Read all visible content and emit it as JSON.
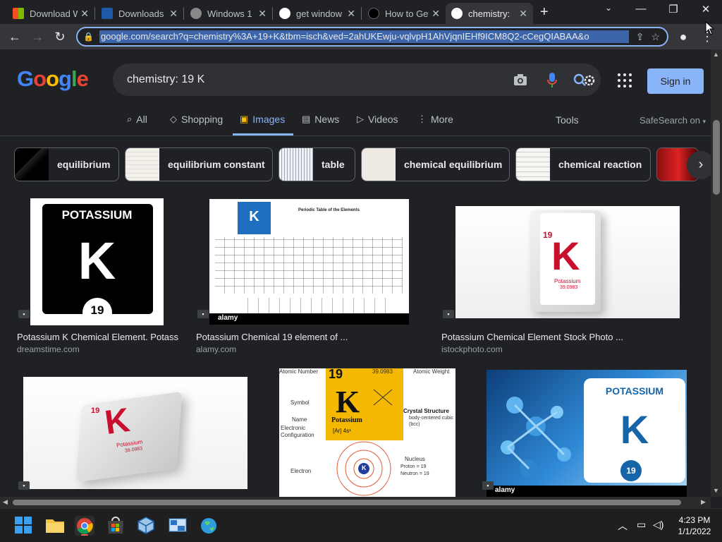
{
  "browser": {
    "tabs": [
      {
        "label": "Download W",
        "active": false
      },
      {
        "label": "Downloads",
        "active": false
      },
      {
        "label": "Windows 1",
        "active": false
      },
      {
        "label": "get window",
        "active": false
      },
      {
        "label": "How to Get",
        "active": false
      },
      {
        "label": "chemistry:",
        "active": true
      }
    ],
    "new_tab": "+",
    "url": "google.com/search?q=chemistry%3A+19+K&tbm=isch&ved=2ahUKEwju-vqlvpH1AhVjqnIEHf9ICM8Q2-cCegQIABAA&o"
  },
  "google": {
    "logo_letters": [
      "G",
      "o",
      "o",
      "g",
      "l",
      "e"
    ],
    "logo_colors": [
      "#4285f4",
      "#ea4335",
      "#fbbc05",
      "#4285f4",
      "#34a853",
      "#ea4335"
    ],
    "query": "chemistry: 19 K",
    "sign_in": "Sign in",
    "nav_tabs": [
      {
        "label": "All",
        "icon": "search-icon"
      },
      {
        "label": "Shopping",
        "icon": "tag-icon"
      },
      {
        "label": "Images",
        "icon": "image-icon"
      },
      {
        "label": "News",
        "icon": "news-icon"
      },
      {
        "label": "Videos",
        "icon": "video-icon"
      },
      {
        "label": "More",
        "icon": "dots-icon"
      }
    ],
    "tools": "Tools",
    "safesearch": "SafeSearch on",
    "chips": [
      {
        "label": "equilibrium"
      },
      {
        "label": "equilibrium constant"
      },
      {
        "label": "table"
      },
      {
        "label": "chemical equilibrium"
      },
      {
        "label": "chemical reaction"
      }
    ],
    "results": [
      {
        "title": "Potassium K Chemical Element. Potass...",
        "source": "dreamstime.com",
        "text_top": "POTASSIUM",
        "symbol": "K",
        "number": "19"
      },
      {
        "title": "Potassium Chemical 19 element of ...",
        "source": "alamy.com",
        "text_top": "Periodic Table of the Elements",
        "symbol": "K",
        "watermark": "alamy"
      },
      {
        "title": "Potassium Chemical Element Stock Photo ...",
        "source": "istockphoto.com",
        "number": "19",
        "symbol": "K",
        "name": "Potassium",
        "weight": "39.0983"
      },
      {
        "number": "19",
        "symbol": "K",
        "name": "Potassium",
        "weight": "39.0983"
      },
      {
        "atomic_number_label": "Atomic Number",
        "atomic_weight_label": "Atomic Weight",
        "number": "19",
        "weight": "39.0983",
        "symbol": "K",
        "name": "Potassium",
        "symbol_label": "Symbol",
        "name_label": "Name",
        "config_label": "Electronic Configuration",
        "config": "[Ar] 4s¹",
        "crystal_label": "Crystal Structure",
        "crystal": "body-centered cubic (bcc)",
        "electron_label": "Electron",
        "nucleus_label": "Nucleus",
        "proton": "Proton = 19",
        "neutron": "Neutron = 19"
      },
      {
        "text_top": "POTASSIUM",
        "symbol": "K",
        "number": "19",
        "watermark": "alamy"
      }
    ]
  },
  "taskbar": {
    "time": "4:23 PM",
    "date": "1/1/2022"
  }
}
